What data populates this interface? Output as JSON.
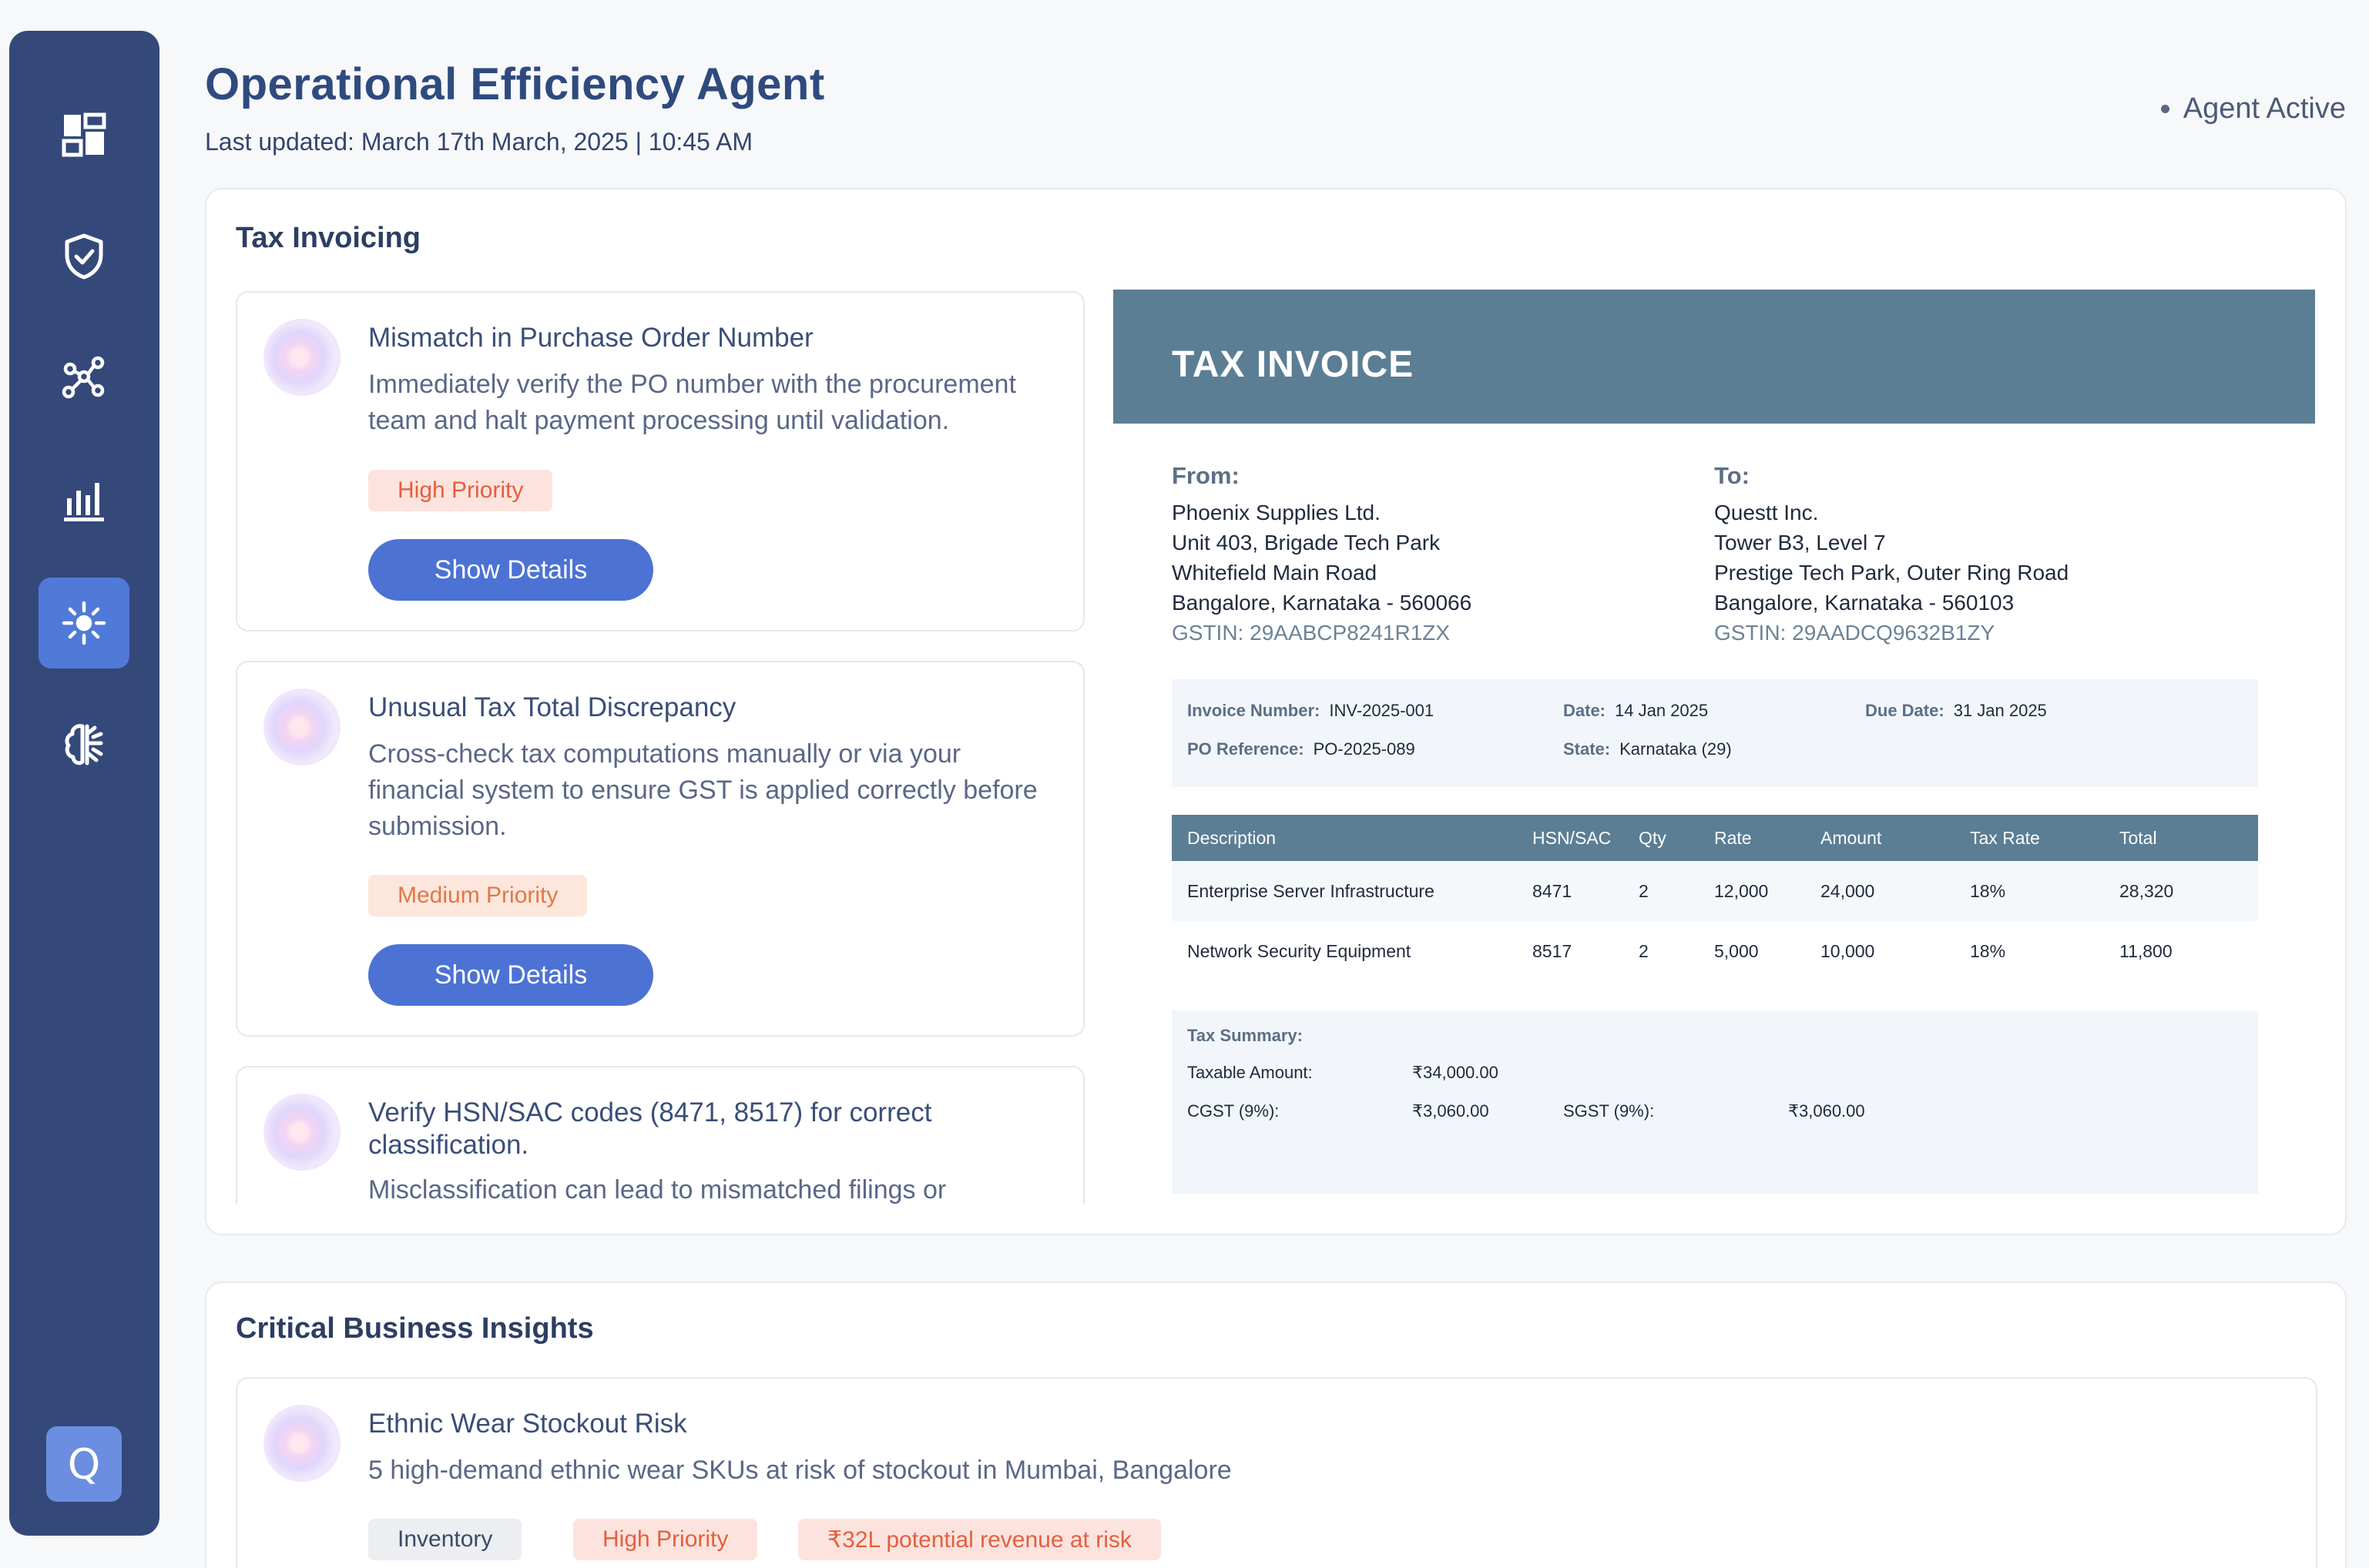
{
  "header": {
    "title": "Operational Efficiency Agent",
    "last_updated": "Last updated: March 17th March, 2025 | 10:45 AM",
    "status": "Agent Active"
  },
  "sidebar": {
    "items": [
      {
        "icon": "dashboard-icon"
      },
      {
        "icon": "shield-check-icon"
      },
      {
        "icon": "network-icon"
      },
      {
        "icon": "bar-chart-icon"
      },
      {
        "icon": "sparkle-icon",
        "active": true
      },
      {
        "icon": "brain-icon"
      }
    ],
    "bottom_button": "Q"
  },
  "tax_invoicing": {
    "title": "Tax Invoicing",
    "cards": [
      {
        "title": "Mismatch in Purchase Order Number",
        "text": "Immediately verify the PO number with the procurement team and halt payment processing until validation.",
        "badge": "High Priority",
        "button": "Show Details"
      },
      {
        "title": "Unusual Tax Total Discrepancy",
        "text": "Cross-check tax computations manually or via your financial system to ensure GST is applied correctly before submission.",
        "badge": "Medium Priority",
        "button": "Show Details"
      },
      {
        "title": "Verify HSN/SAC codes (8471, 8517) for correct classification.",
        "text": "Misclassification can lead to mismatched filings or"
      }
    ]
  },
  "invoice": {
    "title": "TAX INVOICE",
    "from": {
      "label": "From:",
      "lines": [
        "Phoenix Supplies Ltd.",
        "Unit 403, Brigade Tech Park",
        "Whitefield Main Road",
        "Bangalore, Karnataka - 560066"
      ],
      "gstin": "GSTIN: 29AABCP8241R1ZX"
    },
    "to": {
      "label": "To:",
      "lines": [
        "Questt Inc.",
        "Tower B3, Level 7",
        "Prestige Tech Park, Outer Ring Road",
        "Bangalore, Karnataka - 560103"
      ],
      "gstin": "GSTIN: 29AADCQ9632B1ZY"
    },
    "meta": {
      "invoice_number_label": "Invoice Number:",
      "invoice_number": "INV-2025-001",
      "date_label": "Date:",
      "date": "14 Jan 2025",
      "due_label": "Due Date:",
      "due": "31 Jan 2025",
      "po_label": "PO Reference:",
      "po": "PO-2025-089",
      "state_label": "State:",
      "state": "Karnataka (29)"
    },
    "table": {
      "headers": [
        "Description",
        "HSN/SAC",
        "Qty",
        "Rate",
        "Amount",
        "Tax Rate",
        "Total"
      ],
      "rows": [
        [
          "Enterprise Server Infrastructure",
          "8471",
          "2",
          "12,000",
          "24,000",
          "18%",
          "28,320"
        ],
        [
          "Network Security Equipment",
          "8517",
          "2",
          "5,000",
          "10,000",
          "18%",
          "11,800"
        ]
      ]
    },
    "summary": {
      "title": "Tax Summary:",
      "taxable_label": "Taxable Amount:",
      "taxable": "₹34,000.00",
      "cgst_label": "CGST (9%):",
      "cgst": "₹3,060.00",
      "sgst_label": "SGST (9%):",
      "sgst": "₹3,060.00"
    }
  },
  "insights": {
    "title": "Critical Business Insights",
    "cards": [
      {
        "title": "Ethnic Wear Stockout Risk",
        "text": "5 high-demand ethnic wear SKUs at risk of stockout in Mumbai, Bangalore",
        "tags": [
          "Inventory",
          "High Priority",
          "₹32L potential revenue at risk"
        ]
      }
    ]
  }
}
